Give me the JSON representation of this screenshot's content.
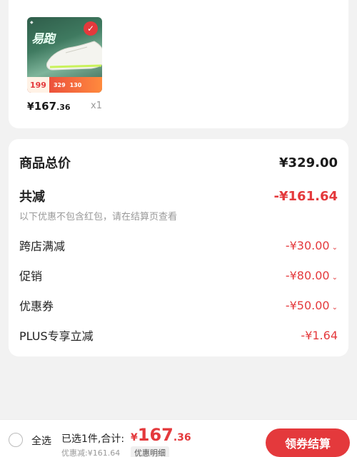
{
  "product": {
    "image_brand": "易跑",
    "promo_price": "199",
    "promo_a": "329",
    "promo_b": "130",
    "price_yen": "¥",
    "price_int": "167",
    "price_dec": ".36",
    "quantity": "x1"
  },
  "summary": {
    "total_label": "商品总价",
    "total_value": "¥329.00",
    "reduce_label": "共减",
    "reduce_value": "-¥161.64",
    "note": "以下优惠不包含红包，请在结算页查看",
    "items": [
      {
        "label": "跨店满减",
        "value": "-¥30.00"
      },
      {
        "label": "促销",
        "value": "-¥80.00"
      },
      {
        "label": "优惠券",
        "value": "-¥50.00"
      },
      {
        "label": "PLUS专享立减",
        "value": "-¥1.64"
      }
    ]
  },
  "bottom": {
    "select_all": "全选",
    "selected_info": "已选1件,合计:",
    "total_yen": "¥",
    "total_int": "167",
    "total_dec": ".36",
    "discount_info": "优惠减:¥161.64",
    "detail_label": "优惠明细",
    "checkout_label": "领券结算"
  },
  "colors": {
    "accent": "#e4393c",
    "background": "#f2f2f2"
  }
}
